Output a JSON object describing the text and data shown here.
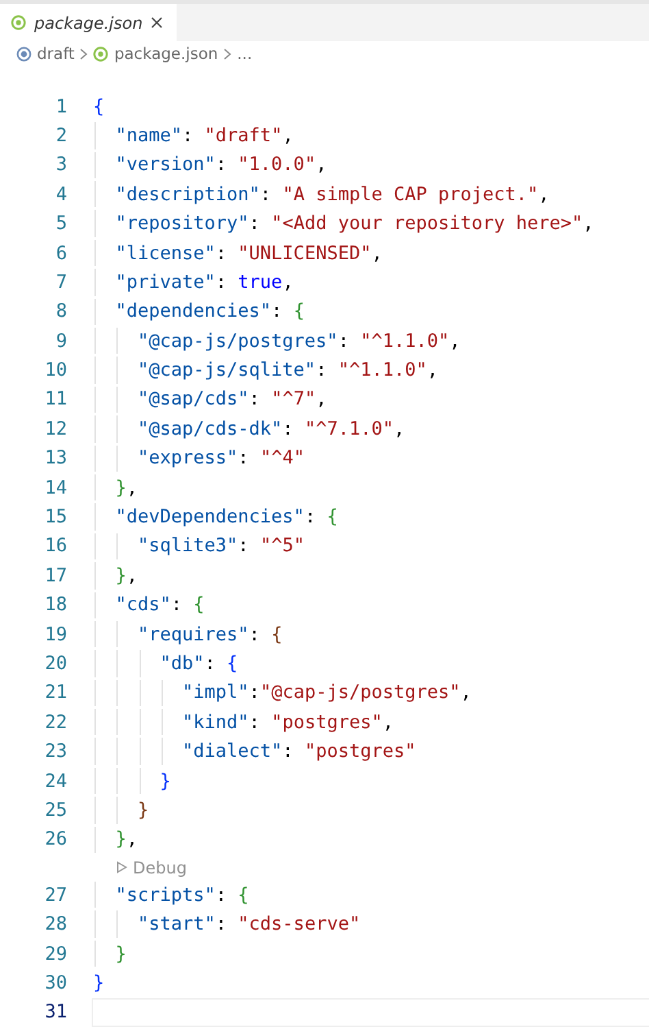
{
  "tabs": [
    {
      "label": "package.json",
      "selected": true,
      "preview": true
    }
  ],
  "breadcrumb": [
    {
      "label": "draft",
      "kind": "folder"
    },
    {
      "label": "package.json",
      "kind": "file"
    },
    {
      "label": "...",
      "kind": "more"
    }
  ],
  "lines": [
    {
      "kind": "code",
      "number": "1",
      "current": false,
      "tokens": [
        {
          "t": "{",
          "kind": "bracket",
          "color": "#0431fa"
        }
      ]
    },
    {
      "kind": "code",
      "number": "2",
      "current": false,
      "tokens": [
        {
          "t": "  \"name\"",
          "kind": "key"
        },
        {
          "t": ": ",
          "kind": "punct"
        },
        {
          "t": "\"draft\"",
          "kind": "string"
        },
        {
          "t": ",",
          "kind": "punct"
        }
      ]
    },
    {
      "kind": "code",
      "number": "3",
      "current": false,
      "tokens": [
        {
          "t": "  \"version\"",
          "kind": "key"
        },
        {
          "t": ": ",
          "kind": "punct"
        },
        {
          "t": "\"1.0.0\"",
          "kind": "string"
        },
        {
          "t": ",",
          "kind": "punct"
        }
      ]
    },
    {
      "kind": "code",
      "number": "4",
      "current": false,
      "tokens": [
        {
          "t": "  \"description\"",
          "kind": "key"
        },
        {
          "t": ": ",
          "kind": "punct"
        },
        {
          "t": "\"A simple CAP project.\"",
          "kind": "string"
        },
        {
          "t": ",",
          "kind": "punct"
        }
      ]
    },
    {
      "kind": "code",
      "number": "5",
      "current": false,
      "tokens": [
        {
          "t": "  \"repository\"",
          "kind": "key"
        },
        {
          "t": ": ",
          "kind": "punct"
        },
        {
          "t": "\"<Add your repository here>\"",
          "kind": "string"
        },
        {
          "t": ",",
          "kind": "punct"
        }
      ]
    },
    {
      "kind": "code",
      "number": "6",
      "current": false,
      "tokens": [
        {
          "t": "  \"license\"",
          "kind": "key"
        },
        {
          "t": ": ",
          "kind": "punct"
        },
        {
          "t": "\"UNLICENSED\"",
          "kind": "string"
        },
        {
          "t": ",",
          "kind": "punct"
        }
      ]
    },
    {
      "kind": "code",
      "number": "7",
      "current": false,
      "tokens": [
        {
          "t": "  \"private\"",
          "kind": "key"
        },
        {
          "t": ": ",
          "kind": "punct"
        },
        {
          "t": "true",
          "kind": "keyword"
        },
        {
          "t": ",",
          "kind": "punct"
        }
      ]
    },
    {
      "kind": "code",
      "number": "8",
      "current": false,
      "tokens": [
        {
          "t": "  \"dependencies\"",
          "kind": "key"
        },
        {
          "t": ": ",
          "kind": "punct"
        },
        {
          "t": "{",
          "kind": "bracket",
          "color": "#319331"
        }
      ]
    },
    {
      "kind": "code",
      "number": "9",
      "current": false,
      "tokens": [
        {
          "t": "    \"@cap-js/postgres\"",
          "kind": "key"
        },
        {
          "t": ": ",
          "kind": "punct"
        },
        {
          "t": "\"^1.1.0\"",
          "kind": "string"
        },
        {
          "t": ",",
          "kind": "punct"
        }
      ]
    },
    {
      "kind": "code",
      "number": "10",
      "current": false,
      "tokens": [
        {
          "t": "    \"@cap-js/sqlite\"",
          "kind": "key"
        },
        {
          "t": ": ",
          "kind": "punct"
        },
        {
          "t": "\"^1.1.0\"",
          "kind": "string"
        },
        {
          "t": ",",
          "kind": "punct"
        }
      ]
    },
    {
      "kind": "code",
      "number": "11",
      "current": false,
      "tokens": [
        {
          "t": "    \"@sap/cds\"",
          "kind": "key"
        },
        {
          "t": ": ",
          "kind": "punct"
        },
        {
          "t": "\"^7\"",
          "kind": "string"
        },
        {
          "t": ",",
          "kind": "punct"
        }
      ]
    },
    {
      "kind": "code",
      "number": "12",
      "current": false,
      "tokens": [
        {
          "t": "    \"@sap/cds-dk\"",
          "kind": "key"
        },
        {
          "t": ": ",
          "kind": "punct"
        },
        {
          "t": "\"^7.1.0\"",
          "kind": "string"
        },
        {
          "t": ",",
          "kind": "punct"
        }
      ]
    },
    {
      "kind": "code",
      "number": "13",
      "current": false,
      "tokens": [
        {
          "t": "    \"express\"",
          "kind": "key"
        },
        {
          "t": ": ",
          "kind": "punct"
        },
        {
          "t": "\"^4\"",
          "kind": "string"
        }
      ]
    },
    {
      "kind": "code",
      "number": "14",
      "current": false,
      "tokens": [
        {
          "t": "  }",
          "kind": "bracket",
          "color": "#319331"
        },
        {
          "t": ",",
          "kind": "punct"
        }
      ]
    },
    {
      "kind": "code",
      "number": "15",
      "current": false,
      "tokens": [
        {
          "t": "  \"devDependencies\"",
          "kind": "key"
        },
        {
          "t": ": ",
          "kind": "punct"
        },
        {
          "t": "{",
          "kind": "bracket",
          "color": "#319331"
        }
      ]
    },
    {
      "kind": "code",
      "number": "16",
      "current": false,
      "tokens": [
        {
          "t": "    \"sqlite3\"",
          "kind": "key"
        },
        {
          "t": ": ",
          "kind": "punct"
        },
        {
          "t": "\"^5\"",
          "kind": "string"
        }
      ]
    },
    {
      "kind": "code",
      "number": "17",
      "current": false,
      "tokens": [
        {
          "t": "  }",
          "kind": "bracket",
          "color": "#319331"
        },
        {
          "t": ",",
          "kind": "punct"
        }
      ]
    },
    {
      "kind": "code",
      "number": "18",
      "current": false,
      "tokens": [
        {
          "t": "  \"cds\"",
          "kind": "key"
        },
        {
          "t": ": ",
          "kind": "punct"
        },
        {
          "t": "{",
          "kind": "bracket",
          "color": "#319331"
        }
      ]
    },
    {
      "kind": "code",
      "number": "19",
      "current": false,
      "tokens": [
        {
          "t": "    \"requires\"",
          "kind": "key"
        },
        {
          "t": ": ",
          "kind": "punct"
        },
        {
          "t": "{",
          "kind": "bracket",
          "color": "#7b3814"
        }
      ]
    },
    {
      "kind": "code",
      "number": "20",
      "current": false,
      "tokens": [
        {
          "t": "      \"db\"",
          "kind": "key"
        },
        {
          "t": ": ",
          "kind": "punct"
        },
        {
          "t": "{",
          "kind": "bracket",
          "color": "#0431fa"
        }
      ]
    },
    {
      "kind": "code",
      "number": "21",
      "current": false,
      "tokens": [
        {
          "t": "        \"impl\"",
          "kind": "key"
        },
        {
          "t": ":",
          "kind": "punct"
        },
        {
          "t": "\"@cap-js/postgres\"",
          "kind": "string"
        },
        {
          "t": ",",
          "kind": "punct"
        }
      ]
    },
    {
      "kind": "code",
      "number": "22",
      "current": false,
      "tokens": [
        {
          "t": "        \"kind\"",
          "kind": "key"
        },
        {
          "t": ": ",
          "kind": "punct"
        },
        {
          "t": "\"postgres\"",
          "kind": "string"
        },
        {
          "t": ",",
          "kind": "punct"
        }
      ]
    },
    {
      "kind": "code",
      "number": "23",
      "current": false,
      "tokens": [
        {
          "t": "        \"dialect\"",
          "kind": "key"
        },
        {
          "t": ": ",
          "kind": "punct"
        },
        {
          "t": "\"postgres\"",
          "kind": "string"
        }
      ]
    },
    {
      "kind": "code",
      "number": "24",
      "current": false,
      "tokens": [
        {
          "t": "      }",
          "kind": "bracket",
          "color": "#0431fa"
        }
      ]
    },
    {
      "kind": "code",
      "number": "25",
      "current": false,
      "tokens": [
        {
          "t": "    }",
          "kind": "bracket",
          "color": "#7b3814"
        }
      ]
    },
    {
      "kind": "code",
      "number": "26",
      "current": false,
      "tokens": [
        {
          "t": "  }",
          "kind": "bracket",
          "color": "#319331"
        },
        {
          "t": ",",
          "kind": "punct"
        }
      ]
    },
    {
      "kind": "codelens",
      "label": "Debug"
    },
    {
      "kind": "code",
      "number": "27",
      "current": false,
      "tokens": [
        {
          "t": "  \"scripts\"",
          "kind": "key"
        },
        {
          "t": ": ",
          "kind": "punct"
        },
        {
          "t": "{",
          "kind": "bracket",
          "color": "#319331"
        }
      ]
    },
    {
      "kind": "code",
      "number": "28",
      "current": false,
      "tokens": [
        {
          "t": "    \"start\"",
          "kind": "key"
        },
        {
          "t": ": ",
          "kind": "punct"
        },
        {
          "t": "\"cds-serve\"",
          "kind": "string"
        }
      ]
    },
    {
      "kind": "code",
      "number": "29",
      "current": false,
      "tokens": [
        {
          "t": "  }",
          "kind": "bracket",
          "color": "#319331"
        }
      ]
    },
    {
      "kind": "code",
      "number": "30",
      "current": false,
      "tokens": [
        {
          "t": "}",
          "kind": "bracket",
          "color": "#0431fa"
        }
      ]
    },
    {
      "kind": "code",
      "number": "31",
      "current": true
    }
  ]
}
